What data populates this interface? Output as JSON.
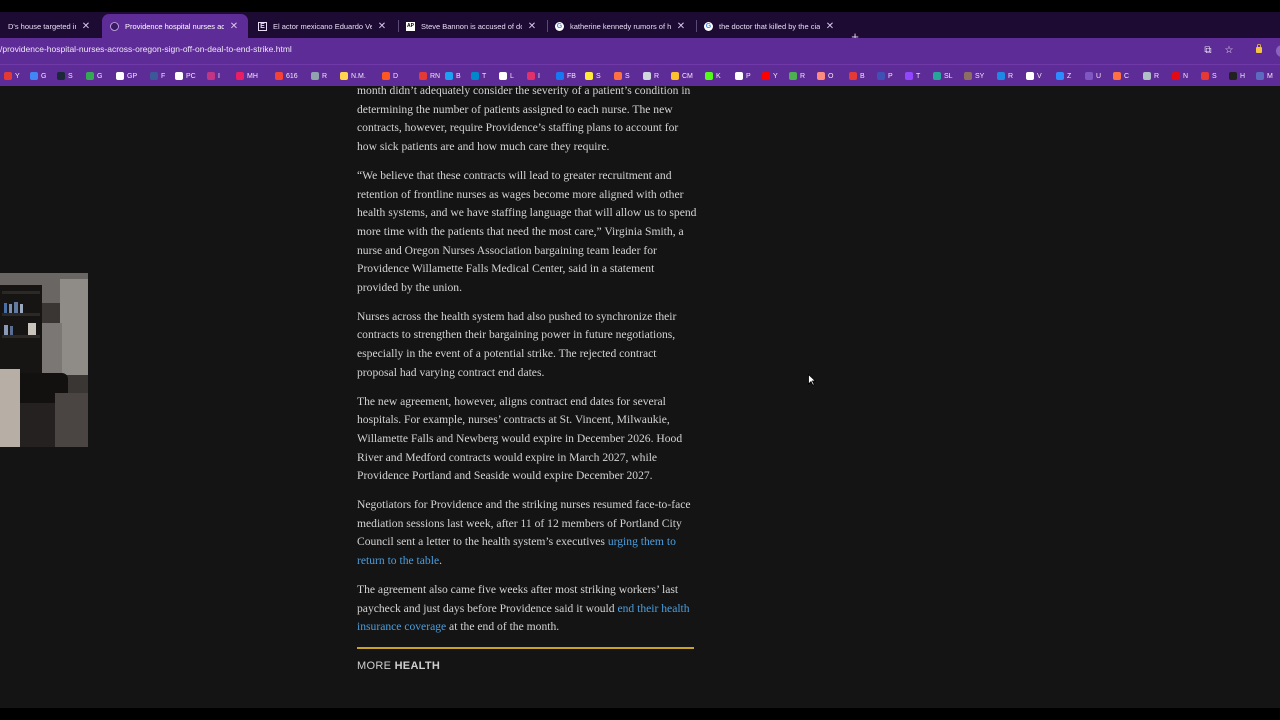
{
  "tabs": [
    {
      "title": "D's house targeted in s",
      "favicon": "",
      "active": false
    },
    {
      "title": "Providence hospital nurses acr",
      "favicon": "",
      "active": true
    },
    {
      "title": "El actor mexicano Eduardo Ver",
      "favicon": "E",
      "active": false
    },
    {
      "title": "Steve Bannon is accused of do",
      "favicon": "AP",
      "active": false
    },
    {
      "title": "katherine kennedy rumors of h",
      "favicon": "G",
      "active": false
    },
    {
      "title": "the doctor that killed by the cia",
      "favicon": "G",
      "active": false
    }
  ],
  "new_tab_label": "+",
  "url": "/providence-hospital-nurses-across-oregon-sign-off-on-deal-to-end-strike.html",
  "bookmarks": [
    {
      "label": "Y",
      "color": "#e53935"
    },
    {
      "label": "G",
      "color": "#4285f4"
    },
    {
      "label": "S",
      "color": "#1b2838"
    },
    {
      "label": "G",
      "color": "#34a853"
    },
    {
      "label": "GP",
      "color": "#ffffff"
    },
    {
      "label": "F",
      "color": "#3b5998"
    },
    {
      "label": "PC",
      "color": "#ffffff"
    },
    {
      "label": "I",
      "color": "#c13584"
    },
    {
      "label": "MH",
      "color": "#e91e63"
    },
    {
      "label": "616",
      "color": "#f44336"
    },
    {
      "label": "R",
      "color": "#90a4ae"
    },
    {
      "label": "N.M.",
      "color": "#ffd54f"
    },
    {
      "label": "D",
      "color": "#ff5722"
    },
    {
      "label": "RN",
      "color": "#e53935"
    },
    {
      "label": "B",
      "color": "#1da1f2"
    },
    {
      "label": "T",
      "color": "#0088cc"
    },
    {
      "label": "L",
      "color": "#ffffff"
    },
    {
      "label": "I",
      "color": "#e1306c"
    },
    {
      "label": "FB",
      "color": "#1877f2"
    },
    {
      "label": "S",
      "color": "#ffeb3b"
    },
    {
      "label": "S",
      "color": "#ff7043"
    },
    {
      "label": "R",
      "color": "#cfd8dc"
    },
    {
      "label": "CM",
      "color": "#fbc02d"
    },
    {
      "label": "K",
      "color": "#53fc18"
    },
    {
      "label": "P",
      "color": "#ffffff"
    },
    {
      "label": "Y",
      "color": "#ff0000"
    },
    {
      "label": "R",
      "color": "#4caf50"
    },
    {
      "label": "O",
      "color": "#ff8a80"
    },
    {
      "label": "B",
      "color": "#e53935"
    },
    {
      "label": "P",
      "color": "#3f51b5"
    },
    {
      "label": "T",
      "color": "#9146ff"
    },
    {
      "label": "SL",
      "color": "#26a69a"
    },
    {
      "label": "SY",
      "color": "#8d6e63"
    },
    {
      "label": "R",
      "color": "#1e88e5"
    },
    {
      "label": "V",
      "color": "#ffffff"
    },
    {
      "label": "Z",
      "color": "#2d8cff"
    },
    {
      "label": "U",
      "color": "#7e57c2"
    },
    {
      "label": "C",
      "color": "#ff7043"
    },
    {
      "label": "R",
      "color": "#b0bec5"
    },
    {
      "label": "N",
      "color": "#e50914"
    },
    {
      "label": "S",
      "color": "#e53935"
    },
    {
      "label": "H",
      "color": "#212121"
    },
    {
      "label": "M",
      "color": "#5c6bc0"
    }
  ],
  "article": {
    "p1": "month didn’t adequately consider the severity of a patient’s condition in determining the number of patients assigned to each nurse. The new contracts, however, require Providence’s staffing plans to account for how sick patients are and how much care they require.",
    "p2": "“We believe that these contracts will lead to greater recruitment and retention of frontline nurses as wages become more aligned with other health systems, and we have staffing language that will allow us to spend more time with the patients that need the most care,” Virginia Smith, a nurse and Oregon Nurses Association bargaining team leader for Providence Willamette Falls Medical Center, said in a statement provided by the union.",
    "p3": "Nurses across the health system had also pushed to synchronize their contracts to strengthen their bargaining power in future negotiations, especially in the event of a potential strike. The rejected contract proposal had varying contract end dates.",
    "p4": "The new agreement, however, aligns contract end dates for several hospitals. For example, nurses’ contracts at St. Vincent, Milwaukie, Willamette Falls and Newberg would expire in December 2026. Hood River and Medford contracts would expire in March 2027, while Providence Portland and Seaside would expire December 2027.",
    "p5_text": "Negotiators for Providence and the striking nurses resumed face-to-face mediation sessions last week, after 11 of 12 members of Portland City Council sent a letter to the health system’s executives ",
    "p5_link": "urging them to return to the table",
    "p5_end": ".",
    "p6_text": "The agreement also came five weeks after most striking workers’ last paycheck and just days before Providence said it would ",
    "p6_link": "end their health insurance coverage",
    "p6_end": " at the end of the month.",
    "more_label": "MORE",
    "more_bold": "HEALTH"
  },
  "colors": {
    "tabbar_bg": "#1d0b33",
    "toolbar_bg": "#5e2c96",
    "page_bg": "#141414",
    "link": "#4a9fdf",
    "divider": "#c9a227"
  }
}
